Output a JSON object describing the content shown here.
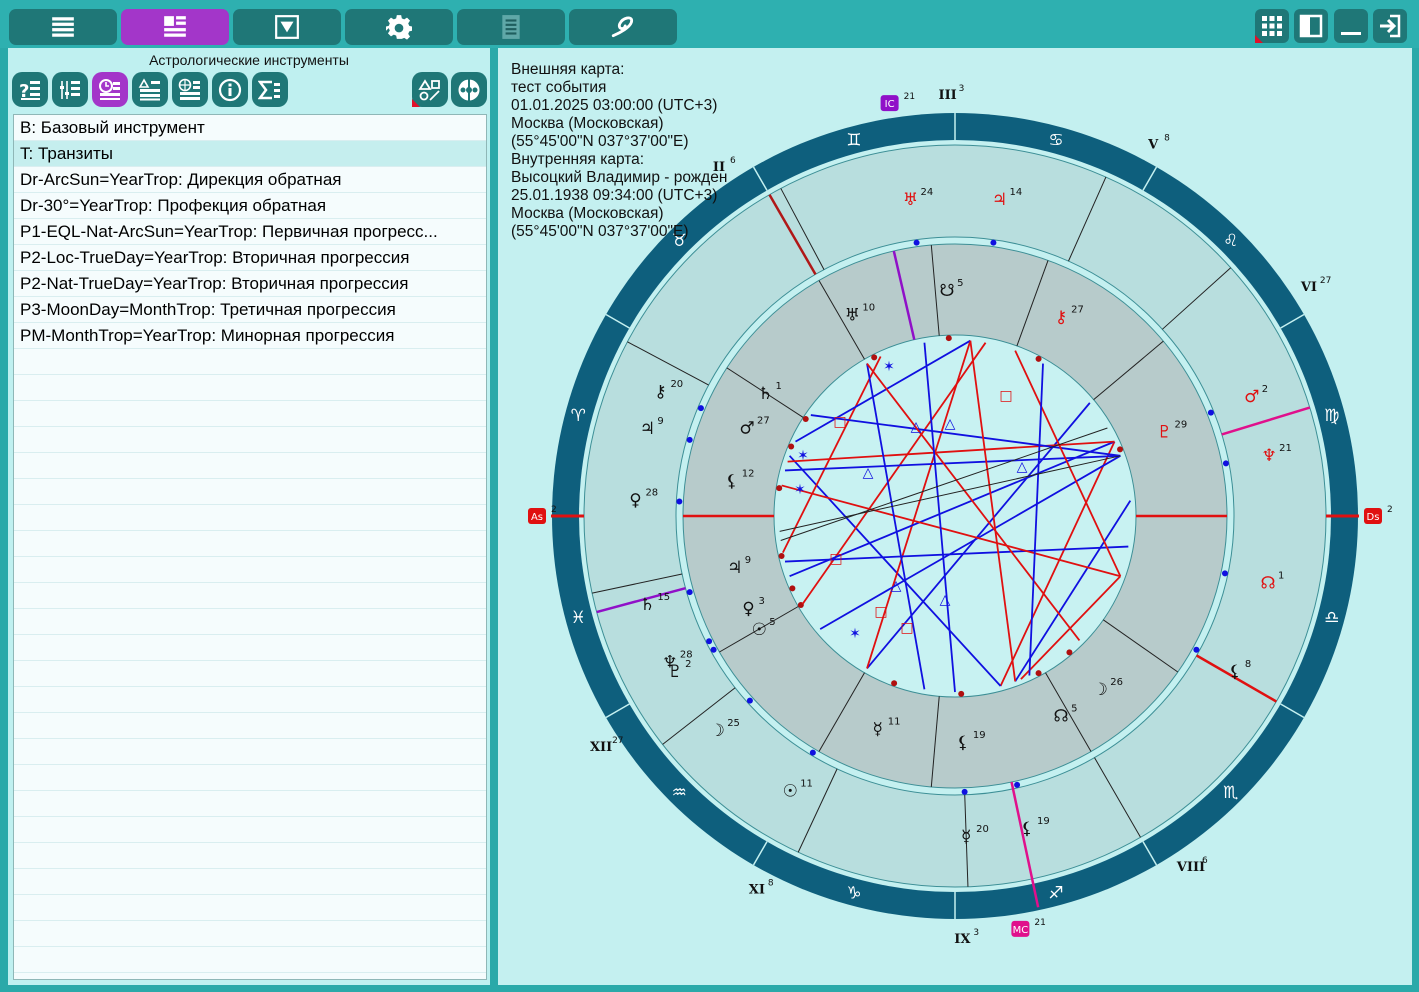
{
  "toolbar": {
    "buttons": [
      {
        "name": "menu-button",
        "icon": "hamburger-icon",
        "active": false
      },
      {
        "name": "charts-list-button",
        "icon": "list-layout-icon",
        "active": true
      },
      {
        "name": "dropdown-button",
        "icon": "dropdown-box-icon",
        "active": false
      },
      {
        "name": "settings-button",
        "icon": "gear-icon",
        "active": false
      },
      {
        "name": "report-button",
        "icon": "document-icon",
        "active": false
      },
      {
        "name": "galaxy-button",
        "icon": "galaxy-icon",
        "active": false
      }
    ],
    "right_buttons": [
      {
        "name": "grid-view-button",
        "icon": "grid-icon"
      },
      {
        "name": "panel-toggle-button",
        "icon": "panel-icon"
      },
      {
        "name": "minimize-button",
        "icon": "minimize-icon"
      },
      {
        "name": "exit-button",
        "icon": "exit-icon"
      }
    ]
  },
  "left_panel": {
    "title": "Астрологические инструменты",
    "tool_buttons": [
      {
        "name": "help-list-button",
        "icon": "question-list-icon",
        "active": false
      },
      {
        "name": "filter-list-button",
        "icon": "sliders-list-icon",
        "active": false
      },
      {
        "name": "clock-list-button",
        "icon": "clock-list-icon",
        "active": true
      },
      {
        "name": "aspects-list-button",
        "icon": "aspects-list-icon",
        "active": false
      },
      {
        "name": "globe-list-button",
        "icon": "globe-list-icon",
        "active": false
      },
      {
        "name": "info-button",
        "icon": "info-icon",
        "active": false
      },
      {
        "name": "sum-button",
        "icon": "sigma-icon",
        "active": false
      }
    ],
    "side_buttons": [
      {
        "name": "aspect-shapes-button",
        "icon": "shapes-icon"
      },
      {
        "name": "wheel-button",
        "icon": "wheel-icon"
      }
    ],
    "items": [
      {
        "label": "B: Базовый инструмент",
        "selected": false
      },
      {
        "label": "T: Транзиты",
        "selected": true
      },
      {
        "label": "Dr-ArcSun=YearTrop: Дирекция обратная",
        "selected": false
      },
      {
        "label": "Dr-30°=YearTrop: Профекция обратная",
        "selected": false
      },
      {
        "label": "P1-EQL-Nat-ArcSun=YearTrop: Первичная прогресс...",
        "selected": false
      },
      {
        "label": "P2-Loc-TrueDay=YearTrop: Вторичная прогрессия",
        "selected": false
      },
      {
        "label": "P2-Nat-TrueDay=YearTrop: Вторичная прогрессия",
        "selected": false
      },
      {
        "label": "P3-MoonDay=MonthTrop: Третичная прогрессия",
        "selected": false
      },
      {
        "label": "PM-MonthTrop=YearTrop: Минорная прогрессия",
        "selected": false
      }
    ]
  },
  "chart_info": [
    "Внешняя карта:",
    "тест события",
    "01.01.2025 03:00:00 (UTC+3)",
    "Москва (Московская)",
    "(55°45'00\"N 037°37'00\"E)",
    "Внутренняя карта:",
    "Высоцкий Владимир - рожден",
    "25.01.1938 09:34:00 (UTC+3)",
    "Москва (Московская)",
    "(55°45'00\"N 037°37'00\"E)"
  ],
  "chart": {
    "colors": {
      "ring": "#0e5f7d",
      "outer_house": "#b8dede",
      "inner_band": "#b7cbcb",
      "center": "#c8f2f2",
      "red": "#e01010",
      "blue": "#1010e0",
      "purple": "#9010c8",
      "magenta": "#e0108c"
    },
    "signs": [
      {
        "glyph": "♐",
        "label": "sagittarius-glyph",
        "lon": 255
      },
      {
        "glyph": "♏",
        "label": "scorpio-glyph",
        "lon": 225
      },
      {
        "glyph": "♎",
        "label": "libra-glyph",
        "lon": 195
      },
      {
        "glyph": "♍",
        "label": "virgo-glyph",
        "lon": 165
      },
      {
        "glyph": "♌",
        "label": "leo-glyph",
        "lon": 135
      },
      {
        "glyph": "♋",
        "label": "cancer-glyph",
        "lon": 105
      },
      {
        "glyph": "♊",
        "label": "gemini-glyph",
        "lon": 75
      },
      {
        "glyph": "♉",
        "label": "taurus-glyph",
        "lon": 45
      },
      {
        "glyph": "♈",
        "label": "aries-glyph",
        "lon": 15
      },
      {
        "glyph": "♓",
        "label": "pisces-glyph",
        "lon": 345
      },
      {
        "glyph": "♒",
        "label": "aquarius-glyph",
        "lon": 315
      },
      {
        "glyph": "♑",
        "label": "capricorn-glyph",
        "lon": 285
      }
    ],
    "axes": [
      {
        "name": "As",
        "degree": "2",
        "color": "#e01010",
        "lon": 0
      },
      {
        "name": "Ds",
        "degree": "2",
        "color": "#e01010",
        "lon": 180
      },
      {
        "name": "MC",
        "degree": "21",
        "color": "#e0108c",
        "lon": 261
      },
      {
        "name": "IC",
        "degree": "21",
        "color": "#9010c8",
        "lon": 81
      }
    ],
    "outer_houses": [
      {
        "numeral": "IX",
        "degree": "3",
        "lon": 269
      },
      {
        "numeral": "VIII",
        "degree": "6",
        "lon": 236
      },
      {
        "numeral": "XII",
        "degree": "27",
        "lon": 327
      },
      {
        "numeral": "XI",
        "degree": "8",
        "lon": 298
      },
      {
        "numeral": "VI",
        "degree": "27",
        "lon": 147
      },
      {
        "numeral": "V",
        "degree": "8",
        "lon": 118
      },
      {
        "numeral": "II",
        "degree": "6",
        "lon": 56
      },
      {
        "numeral": "III",
        "degree": "3",
        "lon": 89
      }
    ],
    "outer_planets": [
      {
        "glyph": "☿",
        "degree": "20",
        "color": "#111111",
        "lon": 268
      },
      {
        "glyph": "☉",
        "degree": "11",
        "color": "#111111",
        "lon": 301
      },
      {
        "glyph": "♀",
        "degree": "28",
        "color": "#111111",
        "lon": 3
      },
      {
        "glyph": "♄",
        "degree": "15",
        "color": "#111111",
        "lon": 344
      },
      {
        "glyph": "♆",
        "degree": "28",
        "color": "#111111",
        "lon": 333
      },
      {
        "glyph": "⚸",
        "degree": "19",
        "color": "#111111",
        "lon": 257
      },
      {
        "glyph": "♇",
        "degree": "2",
        "color": "#111111",
        "lon": 331
      },
      {
        "glyph": "☽",
        "degree": "25",
        "color": "#111111",
        "lon": 318
      },
      {
        "glyph": "♃",
        "degree": "9",
        "color": "#111111",
        "lon": 16
      },
      {
        "glyph": "⚷",
        "degree": "20",
        "color": "#111111",
        "lon": 23
      },
      {
        "glyph": "⚸",
        "degree": "8",
        "color": "#111111",
        "lon": 209
      },
      {
        "glyph": "☊",
        "degree": "1",
        "color": "#e01010",
        "lon": 192
      },
      {
        "glyph": "♆",
        "degree": "21",
        "color": "#e01010",
        "lon": 169
      },
      {
        "glyph": "♂",
        "degree": "2",
        "color": "#e01010",
        "lon": 158
      },
      {
        "glyph": "♅",
        "degree": "24",
        "color": "#e01010",
        "lon": 82
      },
      {
        "glyph": "♃",
        "degree": "14",
        "color": "#e01010",
        "lon": 98
      }
    ],
    "inner_planets": [
      {
        "glyph": "☿",
        "degree": "11",
        "color": "#111111",
        "lon": 290
      },
      {
        "glyph": "⚸",
        "degree": "19",
        "color": "#111111",
        "lon": 268
      },
      {
        "glyph": "☊",
        "degree": "5",
        "color": "#111111",
        "lon": 242
      },
      {
        "glyph": "☽",
        "degree": "26",
        "color": "#111111",
        "lon": 230
      },
      {
        "glyph": "♃",
        "degree": "9",
        "color": "#111111",
        "lon": 347
      },
      {
        "glyph": "⚸",
        "degree": "12",
        "color": "#111111",
        "lon": 9
      },
      {
        "glyph": "♂",
        "degree": "27",
        "color": "#111111",
        "lon": 23
      },
      {
        "glyph": "♄",
        "degree": "1",
        "color": "#111111",
        "lon": 33
      },
      {
        "glyph": "♅",
        "degree": "10",
        "color": "#111111",
        "lon": 63
      },
      {
        "glyph": "☋",
        "degree": "5",
        "color": "#111111",
        "lon": 88
      },
      {
        "glyph": "⚷",
        "degree": "27",
        "color": "#e01010",
        "lon": 118
      },
      {
        "glyph": "♇",
        "degree": "29",
        "color": "#e01010",
        "lon": 158
      },
      {
        "glyph": "☉",
        "degree": "5",
        "color": "#111111",
        "lon": 330
      },
      {
        "glyph": "♀",
        "degree": "3",
        "color": "#111111",
        "lon": 336
      }
    ]
  }
}
